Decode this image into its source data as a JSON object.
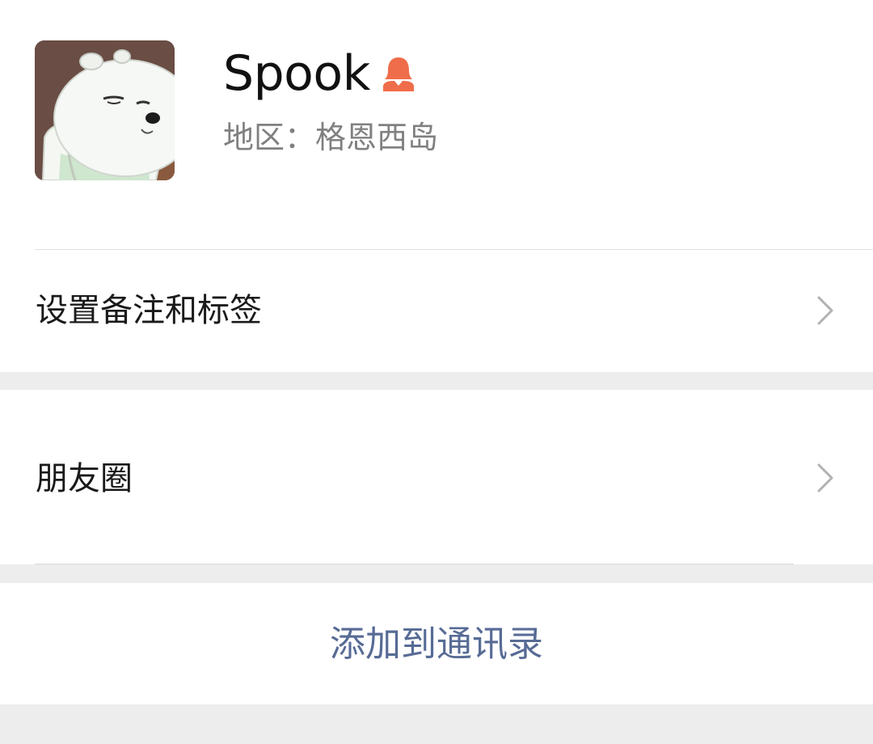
{
  "profile": {
    "name": "Spook",
    "region": "地区：格恩西岛",
    "gender_icon": "female-icon",
    "avatar_icon": "polar-bear-avatar"
  },
  "rows": {
    "remark_label": "设置备注和标签",
    "moments_label": "朋友圈"
  },
  "actions": {
    "add_contact_label": "添加到通讯录"
  },
  "colors": {
    "link": "#576b95",
    "gender_icon": "#f06d4b",
    "background": "#ededed"
  }
}
